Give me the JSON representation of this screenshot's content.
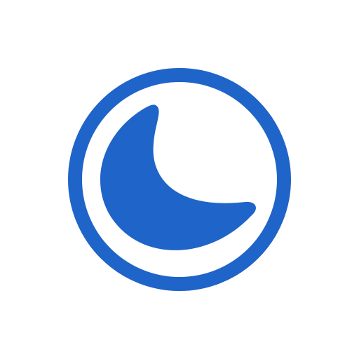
{
  "icon": {
    "name": "moon-in-circle-icon",
    "color": "#1F64C8",
    "background": "#FFFFFF"
  }
}
